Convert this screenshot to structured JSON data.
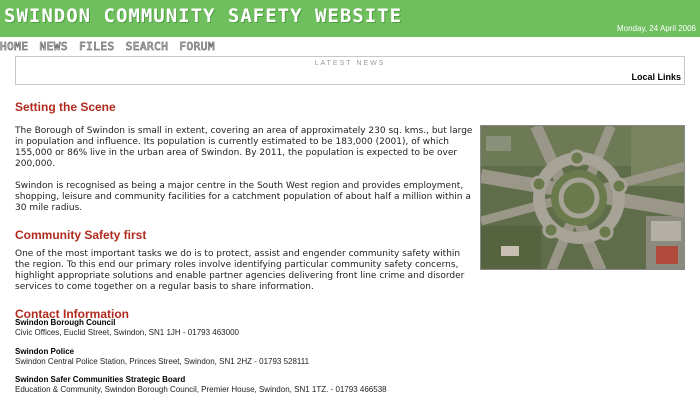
{
  "header": {
    "site_title": "SWINDON COMMUNITY SAFETY WEBSITE",
    "date": "Monday, 24 April 2006"
  },
  "nav": [
    "HOME",
    "NEWS",
    "FILES",
    "SEARCH",
    "FORUM"
  ],
  "news": {
    "label": "LATEST NEWS",
    "local_links": "Local Links"
  },
  "scene": {
    "heading": "Setting the Scene",
    "para1": "The Borough of Swindon is small in extent, covering an area of approximately 230 sq. kms., but large in population and influence. Its population is currently estimated to be 183,000 (2001), of which 155,000 or 86% live in the urban area of Swindon. By 2011, the population is expected to be over 200,000.",
    "para2": "Swindon is recognised as being a major centre in the South West region and provides employment, shopping, leisure and community facilities for a catchment population of about half a million within a 30 mile radius."
  },
  "safety": {
    "heading": "Community Safety first",
    "para": "One of the most important tasks we do is to protect, assist and engender community safety within the region. To this end our primary roles involve identifying particular community safety concerns, highlight appropriate solutions and enable partner agencies delivering front line crime and disorder services to come together on a regular basis to share information."
  },
  "contact": {
    "heading": "Contact Information",
    "entries": [
      {
        "name": "Swindon Borough Council",
        "address": "Civic Offices, Euclid Street, Swindon, SN1 1JH - 01793 463000"
      },
      {
        "name": "Swindon Police",
        "address": "Swindon Central Police Station, Princes Street, Swindon, SN1 2HZ - 01793 528111"
      },
      {
        "name": "Swindon Safer Communities Strategic Board",
        "address": "Education & Community, Swindon Borough Council, Premier House, Swindon, SN1 1TZ. - 01793 466538"
      }
    ]
  },
  "colors": {
    "header_green": "#6fbf5e",
    "heading_red": "#b02a1e"
  }
}
